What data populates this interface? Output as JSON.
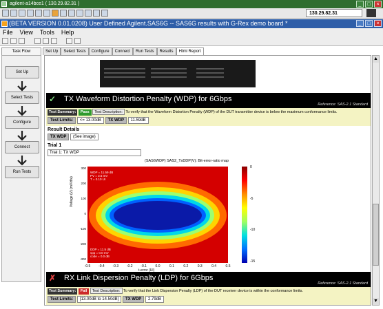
{
  "vnc": {
    "title": "agilent-a14bce1 ( 130.29.82.31 )",
    "address": "130.29.82.31"
  },
  "app": {
    "title": "(BETA VERSION 0.01.0208) User Defined Agilent.SAS6G -- SAS6G results with G-Rex demo board *"
  },
  "menu": [
    "File",
    "View",
    "Tools",
    "Help"
  ],
  "taskflow": {
    "tab_label": "Task Flow",
    "steps": [
      "Set Up",
      "Select Tests",
      "Configure",
      "Connect",
      "Run Tests"
    ]
  },
  "tabs": [
    "Set Up",
    "Select Tests",
    "Configure",
    "Connect",
    "Run Tests",
    "Results",
    "Html Report"
  ],
  "active_tab": "Html Report",
  "wdp": {
    "mark": "✓",
    "title": "TX Waveform Distortion Penalty (WDP) for 6Gbps",
    "reference": "Reference: SAS-2.1 Standard",
    "summary_label": "Test Summary:",
    "status": "Pass",
    "desc_button": "Test Description:",
    "description": "To verify that the Waveform Distortion Penalty (WDP) of the DUT transmitter device is below the maximum conformance limits.",
    "limits_label": "Test Limits:",
    "limits_value": "<= 13.00dB",
    "metric_label": "TX WDP",
    "metric_value": "11.59dB"
  },
  "results": {
    "title": "Result Details",
    "label": "TX WDP",
    "see_image": "(See image)",
    "trial_heading": "Trial 1",
    "trial_value": "Trial 1: TX WDP"
  },
  "plot": {
    "title": "(SAS6WDP) SAS2_TxDDP(V): Bit-error-ratio map",
    "xlabel": "t-error (UI)",
    "ylabel": "Voltage (V) (mV/div)",
    "x_ticks": [
      "-0.5",
      "-0.4",
      "-0.3",
      "-0.2",
      "-0.1",
      "0.0",
      "0.1",
      "0.2",
      "0.3",
      "0.4",
      "0.5"
    ],
    "y_ticks": [
      "300",
      "200",
      "100",
      "0",
      "-100",
      "-200",
      "-300"
    ],
    "colorbar_ticks": [
      "0",
      "-5",
      "-10",
      "-15"
    ],
    "note_top": "WDP = 11.59 dB\nPV = 3.5 mV\nT = 0.10 UI",
    "note_bottom": "DDP = 11.5 dB\nvpp = 0.0 mV\ncode = 0.0 dB"
  },
  "ldp": {
    "mark": "✗",
    "title": "RX Link Dispersion Penalty (LDP) for 6Gbps",
    "reference": "Reference: SAS-2.1 Standard",
    "summary_label": "Test Summary:",
    "status": "Fail",
    "desc_button": "Test Description:",
    "description": "To verify that the Link Dispersion Penalty (LDP) of the DUT receiver device is within the conformance limits.",
    "limits_label": "Test Limits:",
    "limits_value": "[13.00dB to 14.50dB]",
    "metric_label": "TX WDP",
    "metric_value": "2.79dB"
  },
  "colors": {
    "pass": "#2e9a2e",
    "fail": "#cc2a2a",
    "summary_bg": "#f4f3c3",
    "title_bar": "#2e5ea8"
  }
}
